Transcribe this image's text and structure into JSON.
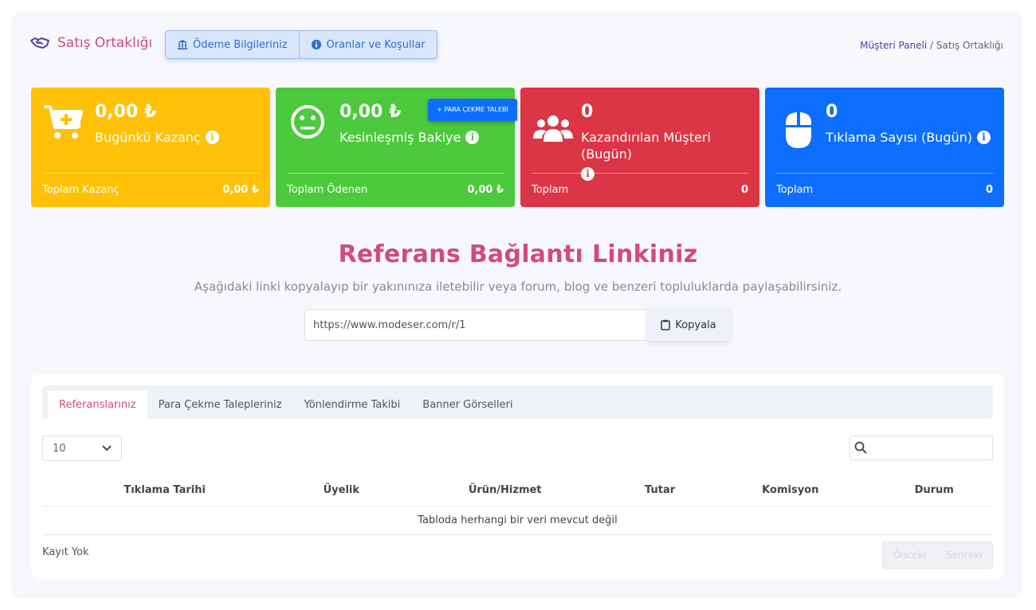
{
  "header": {
    "title": "Satış Ortaklığı",
    "buttons": [
      "Ödeme Bilgileriniz",
      "Oranlar ve Koşullar"
    ],
    "breadcrumb": {
      "link": "Müşteri Paneli",
      "separator": "/",
      "current": "Satış Ortaklığı"
    }
  },
  "cards": [
    {
      "value": "0,00 ₺",
      "label": "Bugünkü Kazanç",
      "foot_label": "Toplam Kazanç",
      "foot_value": "0,00 ₺",
      "color": "#ffc107",
      "icon": "cart-plus-icon"
    },
    {
      "value": "0,00 ₺",
      "label": "Kesinleşmiş Bakiye",
      "foot_label": "Toplam Ödenen",
      "foot_value": "0,00 ₺",
      "color": "#4cc93c",
      "icon": "meh-face-icon"
    },
    {
      "value": "0",
      "label": "Kazandırılan Müşteri (Bugün)",
      "foot_label": "Toplam",
      "foot_value": "0",
      "color": "#dc3545",
      "icon": "users-icon"
    },
    {
      "value": "0",
      "label": "Tıklama Sayısı (Bugün)",
      "foot_label": "Toplam",
      "foot_value": "0",
      "color": "#0d6efd",
      "icon": "mouse-icon"
    }
  ],
  "info_glyph": "i",
  "withdraw_button": "+ PARA ÇEKME TALEBİ",
  "referral": {
    "title": "Referans Bağlantı Linkiniz",
    "subtitle": "Aşağıdaki linki kopyalayıp bir yakınınıza iletebilir veya forum, blog ve benzeri topluluklarda paylaşabilirsiniz.",
    "link": "https://www.modeser.com/r/1",
    "copy_label": "Kopyala"
  },
  "tabs": [
    "Referanslarınız",
    "Para Çekme Talepleriniz",
    "Yönlendirme Takibi",
    "Banner Görselleri"
  ],
  "table": {
    "page_length": "10",
    "search_value": "",
    "columns": [
      "Tıklama Tarihi",
      "Üyelik",
      "Ürün/Hizmet",
      "Tutar",
      "Komisyon",
      "Durum"
    ],
    "empty_message": "Tabloda herhangi bir veri mevcut değil",
    "info": "Kayıt Yok",
    "prev_label": "Önceki",
    "next_label": "Sonraki"
  },
  "colors": {
    "accent": "#d14b7c",
    "primary": "#0d6efd"
  }
}
